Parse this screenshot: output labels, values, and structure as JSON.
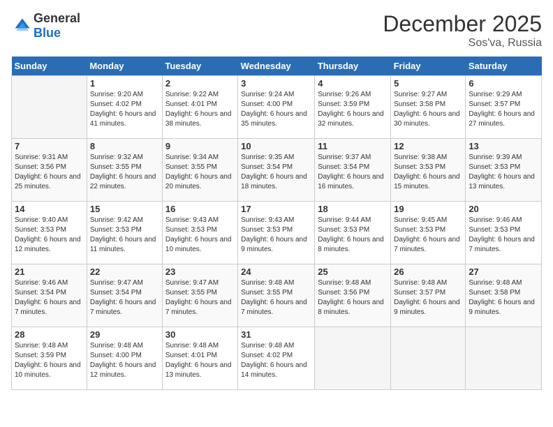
{
  "header": {
    "logo_general": "General",
    "logo_blue": "Blue",
    "month": "December 2025",
    "location": "Sos'va, Russia"
  },
  "weekdays": [
    "Sunday",
    "Monday",
    "Tuesday",
    "Wednesday",
    "Thursday",
    "Friday",
    "Saturday"
  ],
  "weeks": [
    [
      {
        "day": null,
        "sunrise": null,
        "sunset": null,
        "daylight": null
      },
      {
        "day": "1",
        "sunrise": "Sunrise: 9:20 AM",
        "sunset": "Sunset: 4:02 PM",
        "daylight": "Daylight: 6 hours and 41 minutes."
      },
      {
        "day": "2",
        "sunrise": "Sunrise: 9:22 AM",
        "sunset": "Sunset: 4:01 PM",
        "daylight": "Daylight: 6 hours and 38 minutes."
      },
      {
        "day": "3",
        "sunrise": "Sunrise: 9:24 AM",
        "sunset": "Sunset: 4:00 PM",
        "daylight": "Daylight: 6 hours and 35 minutes."
      },
      {
        "day": "4",
        "sunrise": "Sunrise: 9:26 AM",
        "sunset": "Sunset: 3:59 PM",
        "daylight": "Daylight: 6 hours and 32 minutes."
      },
      {
        "day": "5",
        "sunrise": "Sunrise: 9:27 AM",
        "sunset": "Sunset: 3:58 PM",
        "daylight": "Daylight: 6 hours and 30 minutes."
      },
      {
        "day": "6",
        "sunrise": "Sunrise: 9:29 AM",
        "sunset": "Sunset: 3:57 PM",
        "daylight": "Daylight: 6 hours and 27 minutes."
      }
    ],
    [
      {
        "day": "7",
        "sunrise": "Sunrise: 9:31 AM",
        "sunset": "Sunset: 3:56 PM",
        "daylight": "Daylight: 6 hours and 25 minutes."
      },
      {
        "day": "8",
        "sunrise": "Sunrise: 9:32 AM",
        "sunset": "Sunset: 3:55 PM",
        "daylight": "Daylight: 6 hours and 22 minutes."
      },
      {
        "day": "9",
        "sunrise": "Sunrise: 9:34 AM",
        "sunset": "Sunset: 3:55 PM",
        "daylight": "Daylight: 6 hours and 20 minutes."
      },
      {
        "day": "10",
        "sunrise": "Sunrise: 9:35 AM",
        "sunset": "Sunset: 3:54 PM",
        "daylight": "Daylight: 6 hours and 18 minutes."
      },
      {
        "day": "11",
        "sunrise": "Sunrise: 9:37 AM",
        "sunset": "Sunset: 3:54 PM",
        "daylight": "Daylight: 6 hours and 16 minutes."
      },
      {
        "day": "12",
        "sunrise": "Sunrise: 9:38 AM",
        "sunset": "Sunset: 3:53 PM",
        "daylight": "Daylight: 6 hours and 15 minutes."
      },
      {
        "day": "13",
        "sunrise": "Sunrise: 9:39 AM",
        "sunset": "Sunset: 3:53 PM",
        "daylight": "Daylight: 6 hours and 13 minutes."
      }
    ],
    [
      {
        "day": "14",
        "sunrise": "Sunrise: 9:40 AM",
        "sunset": "Sunset: 3:53 PM",
        "daylight": "Daylight: 6 hours and 12 minutes."
      },
      {
        "day": "15",
        "sunrise": "Sunrise: 9:42 AM",
        "sunset": "Sunset: 3:53 PM",
        "daylight": "Daylight: 6 hours and 11 minutes."
      },
      {
        "day": "16",
        "sunrise": "Sunrise: 9:43 AM",
        "sunset": "Sunset: 3:53 PM",
        "daylight": "Daylight: 6 hours and 10 minutes."
      },
      {
        "day": "17",
        "sunrise": "Sunrise: 9:43 AM",
        "sunset": "Sunset: 3:53 PM",
        "daylight": "Daylight: 6 hours and 9 minutes."
      },
      {
        "day": "18",
        "sunrise": "Sunrise: 9:44 AM",
        "sunset": "Sunset: 3:53 PM",
        "daylight": "Daylight: 6 hours and 8 minutes."
      },
      {
        "day": "19",
        "sunrise": "Sunrise: 9:45 AM",
        "sunset": "Sunset: 3:53 PM",
        "daylight": "Daylight: 6 hours and 7 minutes."
      },
      {
        "day": "20",
        "sunrise": "Sunrise: 9:46 AM",
        "sunset": "Sunset: 3:53 PM",
        "daylight": "Daylight: 6 hours and 7 minutes."
      }
    ],
    [
      {
        "day": "21",
        "sunrise": "Sunrise: 9:46 AM",
        "sunset": "Sunset: 3:54 PM",
        "daylight": "Daylight: 6 hours and 7 minutes."
      },
      {
        "day": "22",
        "sunrise": "Sunrise: 9:47 AM",
        "sunset": "Sunset: 3:54 PM",
        "daylight": "Daylight: 6 hours and 7 minutes."
      },
      {
        "day": "23",
        "sunrise": "Sunrise: 9:47 AM",
        "sunset": "Sunset: 3:55 PM",
        "daylight": "Daylight: 6 hours and 7 minutes."
      },
      {
        "day": "24",
        "sunrise": "Sunrise: 9:48 AM",
        "sunset": "Sunset: 3:55 PM",
        "daylight": "Daylight: 6 hours and 7 minutes."
      },
      {
        "day": "25",
        "sunrise": "Sunrise: 9:48 AM",
        "sunset": "Sunset: 3:56 PM",
        "daylight": "Daylight: 6 hours and 8 minutes."
      },
      {
        "day": "26",
        "sunrise": "Sunrise: 9:48 AM",
        "sunset": "Sunset: 3:57 PM",
        "daylight": "Daylight: 6 hours and 9 minutes."
      },
      {
        "day": "27",
        "sunrise": "Sunrise: 9:48 AM",
        "sunset": "Sunset: 3:58 PM",
        "daylight": "Daylight: 6 hours and 9 minutes."
      }
    ],
    [
      {
        "day": "28",
        "sunrise": "Sunrise: 9:48 AM",
        "sunset": "Sunset: 3:59 PM",
        "daylight": "Daylight: 6 hours and 10 minutes."
      },
      {
        "day": "29",
        "sunrise": "Sunrise: 9:48 AM",
        "sunset": "Sunset: 4:00 PM",
        "daylight": "Daylight: 6 hours and 12 minutes."
      },
      {
        "day": "30",
        "sunrise": "Sunrise: 9:48 AM",
        "sunset": "Sunset: 4:01 PM",
        "daylight": "Daylight: 6 hours and 13 minutes."
      },
      {
        "day": "31",
        "sunrise": "Sunrise: 9:48 AM",
        "sunset": "Sunset: 4:02 PM",
        "daylight": "Daylight: 6 hours and 14 minutes."
      },
      {
        "day": null,
        "sunrise": null,
        "sunset": null,
        "daylight": null
      },
      {
        "day": null,
        "sunrise": null,
        "sunset": null,
        "daylight": null
      },
      {
        "day": null,
        "sunrise": null,
        "sunset": null,
        "daylight": null
      }
    ]
  ]
}
